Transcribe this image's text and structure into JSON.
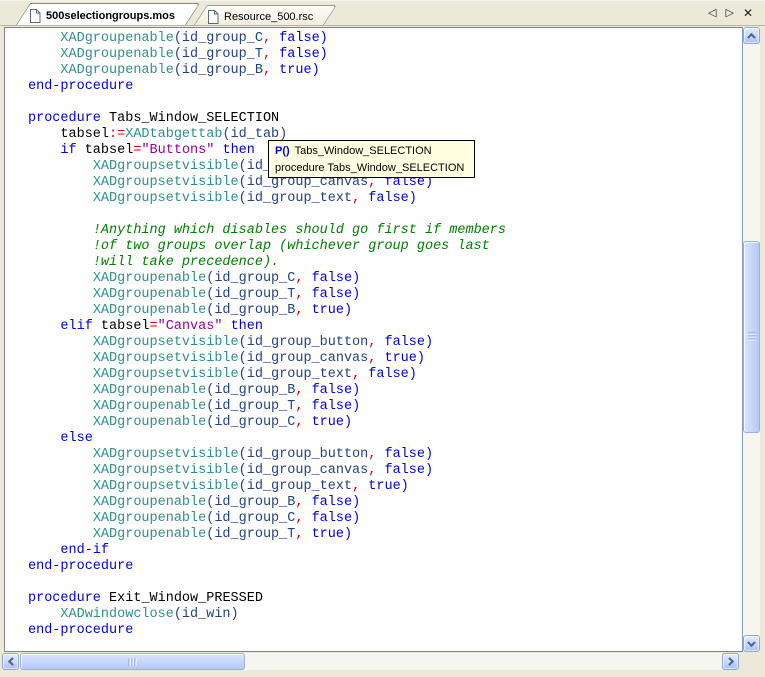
{
  "tab_bar": {
    "tabs": [
      {
        "label": "500selectiongroups.mos",
        "icon": "document-icon",
        "active": true
      },
      {
        "label": "Resource_500.rsc",
        "icon": "document-icon",
        "active": false
      }
    ],
    "scroll_left_glyph": "◁",
    "scroll_right_glyph": "▷",
    "close_glyph": "✕"
  },
  "tooltip": {
    "icon_label": "P()",
    "name": "Tabs_Window_SELECTION",
    "signature": "procedure Tabs_Window_SELECTION"
  },
  "scrollbars": {
    "vertical": {
      "up": "chevron-up-icon",
      "down": "chevron-down-icon"
    },
    "horizontal": {
      "left": "chevron-left-icon",
      "right": "chevron-right-icon"
    }
  },
  "colors": {
    "keyword": "#0000E0",
    "function": "#2E9090",
    "identifier": "#24427C",
    "operator": "#E00000",
    "string": "#990099",
    "comment": "#008000",
    "text": "#000000",
    "tooltip_bg": "#FFFFE1",
    "frame_bg": "#ECE9D8"
  },
  "code_lines": [
    [
      {
        "t": "    ",
        "c": "tx"
      },
      {
        "t": "XADgroupenable",
        "c": "fn"
      },
      {
        "t": "(id_group_C",
        "c": "id"
      },
      {
        "t": ",",
        "c": "op"
      },
      {
        "t": " ",
        "c": "tx"
      },
      {
        "t": "false)",
        "c": "kw"
      }
    ],
    [
      {
        "t": "    ",
        "c": "tx"
      },
      {
        "t": "XADgroupenable",
        "c": "fn"
      },
      {
        "t": "(id_group_T",
        "c": "id"
      },
      {
        "t": ",",
        "c": "op"
      },
      {
        "t": " ",
        "c": "tx"
      },
      {
        "t": "false)",
        "c": "kw"
      }
    ],
    [
      {
        "t": "    ",
        "c": "tx"
      },
      {
        "t": "XADgroupenable",
        "c": "fn"
      },
      {
        "t": "(id_group_B",
        "c": "id"
      },
      {
        "t": ",",
        "c": "op"
      },
      {
        "t": " ",
        "c": "tx"
      },
      {
        "t": "true)",
        "c": "kw"
      }
    ],
    [
      {
        "t": "end-procedure",
        "c": "kw"
      }
    ],
    [],
    [
      {
        "t": "procedure",
        "c": "kw"
      },
      {
        "t": " Tabs_Window_SELECTION",
        "c": "tx"
      }
    ],
    [
      {
        "t": "    tabsel",
        "c": "tx"
      },
      {
        "t": ":=",
        "c": "op"
      },
      {
        "t": "XADtabgettab",
        "c": "fn"
      },
      {
        "t": "(id_tab)",
        "c": "id"
      }
    ],
    [
      {
        "t": "    ",
        "c": "tx"
      },
      {
        "t": "if",
        "c": "kw"
      },
      {
        "t": " tabsel",
        "c": "tx"
      },
      {
        "t": "=",
        "c": "op"
      },
      {
        "t": "\"Buttons\"",
        "c": "str"
      },
      {
        "t": " ",
        "c": "tx"
      },
      {
        "t": "then",
        "c": "kw"
      }
    ],
    [
      {
        "t": "        ",
        "c": "tx"
      },
      {
        "t": "XADgroupsetvisible",
        "c": "fn"
      },
      {
        "t": "(id_group_button",
        "c": "id"
      },
      {
        "t": ",",
        "c": "op"
      },
      {
        "t": " ",
        "c": "tx"
      },
      {
        "t": "false)",
        "c": "kw"
      }
    ],
    [
      {
        "t": "        ",
        "c": "tx"
      },
      {
        "t": "XADgroupsetvisible",
        "c": "fn"
      },
      {
        "t": "(id_group_canvas",
        "c": "id"
      },
      {
        "t": ",",
        "c": "op"
      },
      {
        "t": " ",
        "c": "tx"
      },
      {
        "t": "false)",
        "c": "kw"
      }
    ],
    [
      {
        "t": "        ",
        "c": "tx"
      },
      {
        "t": "XADgroupsetvisible",
        "c": "fn"
      },
      {
        "t": "(id_group_text",
        "c": "id"
      },
      {
        "t": ",",
        "c": "op"
      },
      {
        "t": " ",
        "c": "tx"
      },
      {
        "t": "false)",
        "c": "kw"
      }
    ],
    [],
    [
      {
        "t": "        ",
        "c": "tx"
      },
      {
        "t": "!Anything which disables should go first if members",
        "c": "cm"
      }
    ],
    [
      {
        "t": "        ",
        "c": "tx"
      },
      {
        "t": "!of two groups overlap (whichever group goes last",
        "c": "cm"
      }
    ],
    [
      {
        "t": "        ",
        "c": "tx"
      },
      {
        "t": "!will take precedence).",
        "c": "cm"
      }
    ],
    [
      {
        "t": "        ",
        "c": "tx"
      },
      {
        "t": "XADgroupenable",
        "c": "fn"
      },
      {
        "t": "(id_group_C",
        "c": "id"
      },
      {
        "t": ",",
        "c": "op"
      },
      {
        "t": " ",
        "c": "tx"
      },
      {
        "t": "false)",
        "c": "kw"
      }
    ],
    [
      {
        "t": "        ",
        "c": "tx"
      },
      {
        "t": "XADgroupenable",
        "c": "fn"
      },
      {
        "t": "(id_group_T",
        "c": "id"
      },
      {
        "t": ",",
        "c": "op"
      },
      {
        "t": " ",
        "c": "tx"
      },
      {
        "t": "false)",
        "c": "kw"
      }
    ],
    [
      {
        "t": "        ",
        "c": "tx"
      },
      {
        "t": "XADgroupenable",
        "c": "fn"
      },
      {
        "t": "(id_group_B",
        "c": "id"
      },
      {
        "t": ",",
        "c": "op"
      },
      {
        "t": " ",
        "c": "tx"
      },
      {
        "t": "true)",
        "c": "kw"
      }
    ],
    [
      {
        "t": "    ",
        "c": "tx"
      },
      {
        "t": "elif",
        "c": "kw"
      },
      {
        "t": " tabsel",
        "c": "tx"
      },
      {
        "t": "=",
        "c": "op"
      },
      {
        "t": "\"Canvas\"",
        "c": "str"
      },
      {
        "t": " ",
        "c": "tx"
      },
      {
        "t": "then",
        "c": "kw"
      }
    ],
    [
      {
        "t": "        ",
        "c": "tx"
      },
      {
        "t": "XADgroupsetvisible",
        "c": "fn"
      },
      {
        "t": "(id_group_button",
        "c": "id"
      },
      {
        "t": ",",
        "c": "op"
      },
      {
        "t": " ",
        "c": "tx"
      },
      {
        "t": "false)",
        "c": "kw"
      }
    ],
    [
      {
        "t": "        ",
        "c": "tx"
      },
      {
        "t": "XADgroupsetvisible",
        "c": "fn"
      },
      {
        "t": "(id_group_canvas",
        "c": "id"
      },
      {
        "t": ",",
        "c": "op"
      },
      {
        "t": " ",
        "c": "tx"
      },
      {
        "t": "true)",
        "c": "kw"
      }
    ],
    [
      {
        "t": "        ",
        "c": "tx"
      },
      {
        "t": "XADgroupsetvisible",
        "c": "fn"
      },
      {
        "t": "(id_group_text",
        "c": "id"
      },
      {
        "t": ",",
        "c": "op"
      },
      {
        "t": " ",
        "c": "tx"
      },
      {
        "t": "false)",
        "c": "kw"
      }
    ],
    [
      {
        "t": "        ",
        "c": "tx"
      },
      {
        "t": "XADgroupenable",
        "c": "fn"
      },
      {
        "t": "(id_group_B",
        "c": "id"
      },
      {
        "t": ",",
        "c": "op"
      },
      {
        "t": " ",
        "c": "tx"
      },
      {
        "t": "false)",
        "c": "kw"
      }
    ],
    [
      {
        "t": "        ",
        "c": "tx"
      },
      {
        "t": "XADgroupenable",
        "c": "fn"
      },
      {
        "t": "(id_group_T",
        "c": "id"
      },
      {
        "t": ",",
        "c": "op"
      },
      {
        "t": " ",
        "c": "tx"
      },
      {
        "t": "false)",
        "c": "kw"
      }
    ],
    [
      {
        "t": "        ",
        "c": "tx"
      },
      {
        "t": "XADgroupenable",
        "c": "fn"
      },
      {
        "t": "(id_group_C",
        "c": "id"
      },
      {
        "t": ",",
        "c": "op"
      },
      {
        "t": " ",
        "c": "tx"
      },
      {
        "t": "true)",
        "c": "kw"
      }
    ],
    [
      {
        "t": "    ",
        "c": "tx"
      },
      {
        "t": "else",
        "c": "kw"
      }
    ],
    [
      {
        "t": "        ",
        "c": "tx"
      },
      {
        "t": "XADgroupsetvisible",
        "c": "fn"
      },
      {
        "t": "(id_group_button",
        "c": "id"
      },
      {
        "t": ",",
        "c": "op"
      },
      {
        "t": " ",
        "c": "tx"
      },
      {
        "t": "false)",
        "c": "kw"
      }
    ],
    [
      {
        "t": "        ",
        "c": "tx"
      },
      {
        "t": "XADgroupsetvisible",
        "c": "fn"
      },
      {
        "t": "(id_group_canvas",
        "c": "id"
      },
      {
        "t": ",",
        "c": "op"
      },
      {
        "t": " ",
        "c": "tx"
      },
      {
        "t": "false)",
        "c": "kw"
      }
    ],
    [
      {
        "t": "        ",
        "c": "tx"
      },
      {
        "t": "XADgroupsetvisible",
        "c": "fn"
      },
      {
        "t": "(id_group_text",
        "c": "id"
      },
      {
        "t": ",",
        "c": "op"
      },
      {
        "t": " ",
        "c": "tx"
      },
      {
        "t": "true)",
        "c": "kw"
      }
    ],
    [
      {
        "t": "        ",
        "c": "tx"
      },
      {
        "t": "XADgroupenable",
        "c": "fn"
      },
      {
        "t": "(id_group_B",
        "c": "id"
      },
      {
        "t": ",",
        "c": "op"
      },
      {
        "t": " ",
        "c": "tx"
      },
      {
        "t": "false)",
        "c": "kw"
      }
    ],
    [
      {
        "t": "        ",
        "c": "tx"
      },
      {
        "t": "XADgroupenable",
        "c": "fn"
      },
      {
        "t": "(id_group_C",
        "c": "id"
      },
      {
        "t": ",",
        "c": "op"
      },
      {
        "t": " ",
        "c": "tx"
      },
      {
        "t": "false)",
        "c": "kw"
      }
    ],
    [
      {
        "t": "        ",
        "c": "tx"
      },
      {
        "t": "XADgroupenable",
        "c": "fn"
      },
      {
        "t": "(id_group_T",
        "c": "id"
      },
      {
        "t": ",",
        "c": "op"
      },
      {
        "t": " ",
        "c": "tx"
      },
      {
        "t": "true)",
        "c": "kw"
      }
    ],
    [
      {
        "t": "    ",
        "c": "tx"
      },
      {
        "t": "end-if",
        "c": "kw"
      }
    ],
    [
      {
        "t": "end-procedure",
        "c": "kw"
      }
    ],
    [],
    [
      {
        "t": "procedure",
        "c": "kw"
      },
      {
        "t": " Exit_Window_PRESSED",
        "c": "tx"
      }
    ],
    [
      {
        "t": "    ",
        "c": "tx"
      },
      {
        "t": "XADwindowclose",
        "c": "fn"
      },
      {
        "t": "(id_win)",
        "c": "id"
      }
    ],
    [
      {
        "t": "end-procedure",
        "c": "kw"
      }
    ]
  ]
}
